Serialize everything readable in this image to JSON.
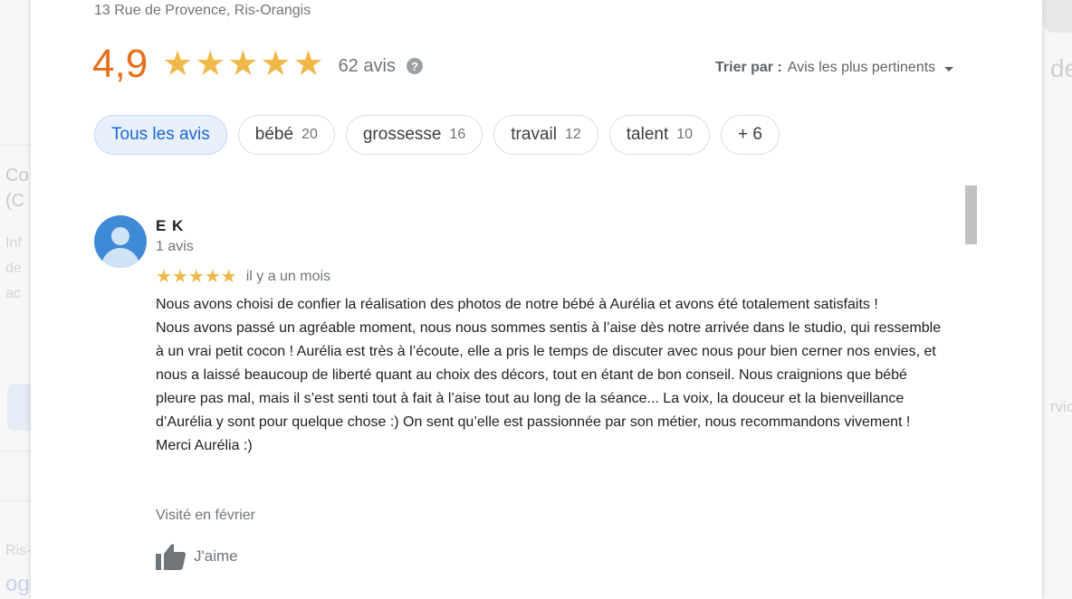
{
  "background": {
    "left_fragments": [
      "Co",
      "(C",
      "Inf",
      "de",
      "ac",
      "Ris-",
      "og"
    ],
    "right_fragments": [
      "de",
      "rvic"
    ]
  },
  "dialog": {
    "address": "13 Rue de Provence, Ris-Orangis",
    "rating": "4,9",
    "stars_filled": 5,
    "review_count": "62 avis",
    "help_icon_glyph": "?",
    "sort": {
      "label": "Trier par :",
      "value": "Avis les plus pertinents"
    },
    "filters": [
      {
        "label": "Tous les avis",
        "count": "",
        "active": true
      },
      {
        "label": "bébé",
        "count": "20",
        "active": false
      },
      {
        "label": "grossesse",
        "count": "16",
        "active": false
      },
      {
        "label": "travail",
        "count": "12",
        "active": false
      },
      {
        "label": "talent",
        "count": "10",
        "active": false
      },
      {
        "label": "+ 6",
        "count": "",
        "active": false
      }
    ],
    "review": {
      "author": "E K",
      "author_reviews": "1 avis",
      "stars": 5,
      "time": "il y a un mois",
      "paragraphs": [
        "Nous avons choisi de confier la réalisation des photos de notre bébé à Aurélia et avons été totalement satisfaits !",
        "Nous avons passé un agréable moment, nous nous sommes sentis à l’aise dès notre arrivée dans le studio, qui ressemble à un vrai petit cocon ! Aurélia est très à l’écoute, elle a pris le temps de discuter avec nous pour bien cerner nos envies, et nous a laissé beaucoup de liberté quant au choix des décors, tout en étant de bon conseil. Nous craignions que bébé pleure pas mal, mais il s’est senti tout à fait à l’aise tout au long de la séance... La voix, la douceur et la bienveillance d’Aurélia y sont pour quelque chose :) On sent qu’elle est passionnée par son métier, nous recommandons vivement !",
        "Merci Aurélia :)"
      ],
      "visited": "Visité en février",
      "like_label": "J'aime"
    }
  },
  "colors": {
    "rating": "#e7711b",
    "star": "#f0b849",
    "active_chip_bg": "#e8f0fe",
    "active_chip_text": "#1967d2",
    "avatar": "#3e8ad6"
  }
}
